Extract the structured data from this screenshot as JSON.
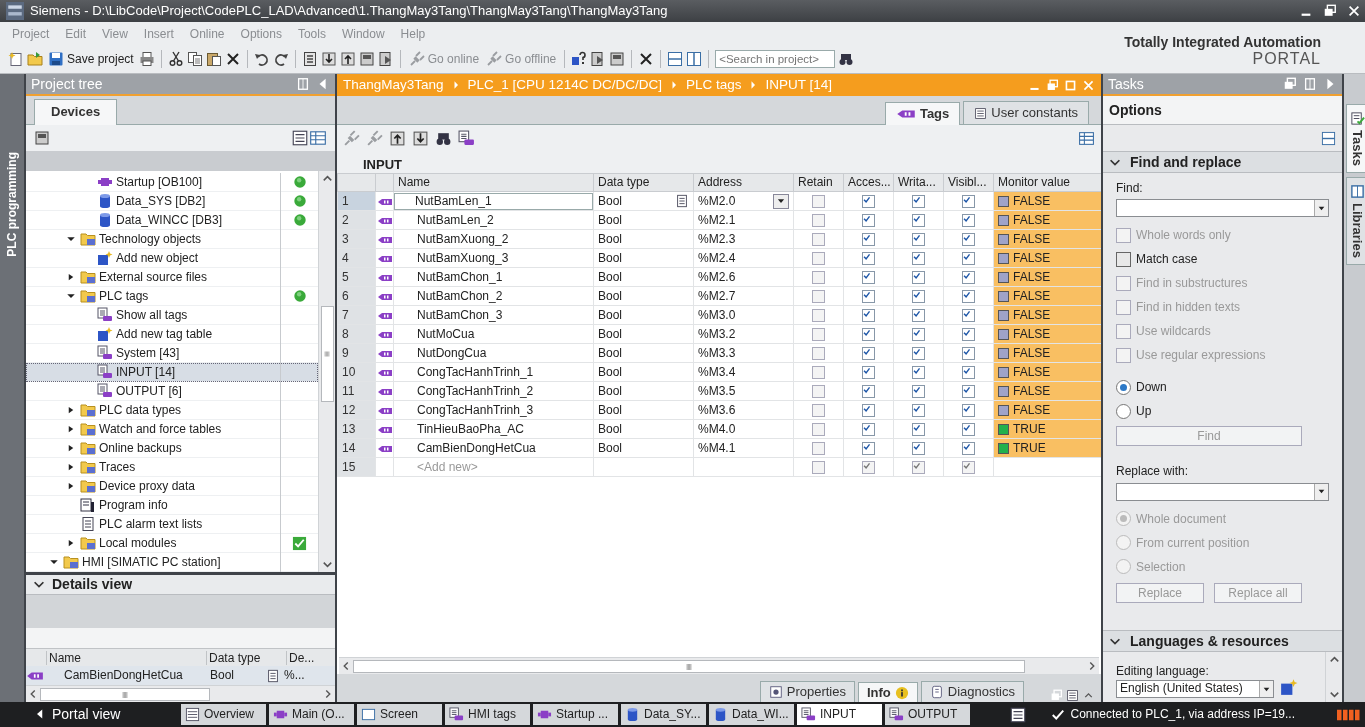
{
  "window": {
    "title": "Siemens  -  D:\\LibCode\\Project\\CodePLC_LAD\\Advanced\\1.ThangMay3Tang\\ThangMay3Tang\\ThangMay3Tang"
  },
  "menu": [
    "Project",
    "Edit",
    "View",
    "Insert",
    "Online",
    "Options",
    "Tools",
    "Window",
    "Help"
  ],
  "toolbar": {
    "buttons": [
      {
        "label": "Save project",
        "disabled": false
      },
      {
        "label": "Go online",
        "disabled": true
      },
      {
        "label": "Go offline",
        "disabled": true
      }
    ],
    "search_placeholder": "<Search in project>"
  },
  "brand": {
    "line1": "Totally Integrated Automation",
    "line2": "PORTAL"
  },
  "side_strip": "PLC programming",
  "project_tree": {
    "title": "Project tree",
    "tabs": [
      {
        "label": "Devices",
        "selected": true
      }
    ],
    "items": [
      {
        "kind": "continued",
        "children": [
          {
            "kind": "continued",
            "children": [
              {
                "kind": "block",
                "label": "Startup [OB100]",
                "status_ok": true,
                "selected": false
              },
              {
                "kind": "db",
                "label": "Data_SYS [DB2]",
                "status_ok": true,
                "selected": false
              },
              {
                "kind": "db",
                "label": "Data_WINCC [DB3]",
                "status_ok": true,
                "selected": false
              }
            ]
          },
          {
            "kind": "folder",
            "label": "Technology objects",
            "expanded": true,
            "selected": false,
            "children": [
              {
                "kind": "add",
                "label": "Add new object",
                "selected": false
              }
            ]
          },
          {
            "kind": "folder",
            "label": "External source files",
            "expanded": false,
            "selected": false
          },
          {
            "kind": "folder",
            "label": "PLC tags",
            "expanded": true,
            "status_ok": true,
            "selected": false,
            "children": [
              {
                "kind": "tags",
                "label": "Show all tags",
                "selected": false
              },
              {
                "kind": "add",
                "label": "Add new tag table",
                "selected": false
              },
              {
                "kind": "tags",
                "label": "System [43]",
                "selected": false
              },
              {
                "kind": "tags",
                "label": "INPUT [14]",
                "selected": true
              },
              {
                "kind": "tags",
                "label": "OUTPUT [6]",
                "selected": false
              }
            ]
          },
          {
            "kind": "folder",
            "label": "PLC data types",
            "expanded": false,
            "selected": false
          },
          {
            "kind": "folder",
            "label": "Watch and force tables",
            "expanded": false,
            "selected": false
          },
          {
            "kind": "folder",
            "label": "Online backups",
            "expanded": false,
            "selected": false
          },
          {
            "kind": "folder",
            "label": "Traces",
            "expanded": false,
            "selected": false
          },
          {
            "kind": "folder",
            "label": "Device proxy data",
            "expanded": false,
            "selected": false
          },
          {
            "kind": "info",
            "label": "Program info",
            "selected": false
          },
          {
            "kind": "list",
            "label": "PLC alarm text lists",
            "selected": false
          },
          {
            "kind": "folder",
            "label": "Local modules",
            "expanded": false,
            "status_checked": true,
            "selected": false
          }
        ]
      },
      {
        "kind": "folder",
        "label": "HMI [SIMATIC PC station]",
        "expanded": true,
        "selected": false
      }
    ]
  },
  "details_view": {
    "title": "Details view",
    "expanded": true,
    "columns": [
      "Name",
      "Data type",
      "De..."
    ],
    "rows": [
      {
        "name": "CamBienDongHetCua",
        "data_type": "Bool",
        "column_3": "%..."
      }
    ]
  },
  "editor": {
    "breadcrumb": [
      "ThangMay3Tang",
      "PLC_1 [CPU 1214C DC/DC/DC]",
      "PLC tags",
      "INPUT [14]"
    ],
    "tabs": [
      {
        "label": "Tags",
        "selected": true
      },
      {
        "label": "User constants",
        "selected": false
      }
    ],
    "table_title": "INPUT",
    "columns": [
      "Name",
      "Data type",
      "Address",
      "Retain",
      "Acces...",
      "Writa...",
      "Visibl...",
      "Monitor value"
    ],
    "rows": [
      {
        "number": "1",
        "name": "NutBamLen_1",
        "data_type": "Bool",
        "address": "%M2.0",
        "retain": false,
        "accessible": true,
        "writable": true,
        "visible": true,
        "monitor": "FALSE",
        "monitor_on": false,
        "selected": true
      },
      {
        "number": "2",
        "name": "NutBamLen_2",
        "data_type": "Bool",
        "address": "%M2.1",
        "retain": false,
        "accessible": true,
        "writable": true,
        "visible": true,
        "monitor": "FALSE",
        "monitor_on": false,
        "selected": false
      },
      {
        "number": "3",
        "name": "NutBamXuong_2",
        "data_type": "Bool",
        "address": "%M2.3",
        "retain": false,
        "accessible": true,
        "writable": true,
        "visible": true,
        "monitor": "FALSE",
        "monitor_on": false,
        "selected": false
      },
      {
        "number": "4",
        "name": "NutBamXuong_3",
        "data_type": "Bool",
        "address": "%M2.4",
        "retain": false,
        "accessible": true,
        "writable": true,
        "visible": true,
        "monitor": "FALSE",
        "monitor_on": false,
        "selected": false
      },
      {
        "number": "5",
        "name": "NutBamChon_1",
        "data_type": "Bool",
        "address": "%M2.6",
        "retain": false,
        "accessible": true,
        "writable": true,
        "visible": true,
        "monitor": "FALSE",
        "monitor_on": false,
        "selected": false
      },
      {
        "number": "6",
        "name": "NutBamChon_2",
        "data_type": "Bool",
        "address": "%M2.7",
        "retain": false,
        "accessible": true,
        "writable": true,
        "visible": true,
        "monitor": "FALSE",
        "monitor_on": false,
        "selected": false
      },
      {
        "number": "7",
        "name": "NutBamChon_3",
        "data_type": "Bool",
        "address": "%M3.0",
        "retain": false,
        "accessible": true,
        "writable": true,
        "visible": true,
        "monitor": "FALSE",
        "monitor_on": false,
        "selected": false
      },
      {
        "number": "8",
        "name": "NutMoCua",
        "data_type": "Bool",
        "address": "%M3.2",
        "retain": false,
        "accessible": true,
        "writable": true,
        "visible": true,
        "monitor": "FALSE",
        "monitor_on": false,
        "selected": false
      },
      {
        "number": "9",
        "name": "NutDongCua",
        "data_type": "Bool",
        "address": "%M3.3",
        "retain": false,
        "accessible": true,
        "writable": true,
        "visible": true,
        "monitor": "FALSE",
        "monitor_on": false,
        "selected": false
      },
      {
        "number": "10",
        "name": "CongTacHanhTrinh_1",
        "data_type": "Bool",
        "address": "%M3.4",
        "retain": false,
        "accessible": true,
        "writable": true,
        "visible": true,
        "monitor": "FALSE",
        "monitor_on": false,
        "selected": false
      },
      {
        "number": "11",
        "name": "CongTacHanhTrinh_2",
        "data_type": "Bool",
        "address": "%M3.5",
        "retain": false,
        "accessible": true,
        "writable": true,
        "visible": true,
        "monitor": "FALSE",
        "monitor_on": false,
        "selected": false
      },
      {
        "number": "12",
        "name": "CongTacHanhTrinh_3",
        "data_type": "Bool",
        "address": "%M3.6",
        "retain": false,
        "accessible": true,
        "writable": true,
        "visible": true,
        "monitor": "FALSE",
        "monitor_on": false,
        "selected": false
      },
      {
        "number": "13",
        "name": "TinHieuBaoPha_AC",
        "data_type": "Bool",
        "address": "%M4.0",
        "retain": false,
        "accessible": true,
        "writable": true,
        "visible": true,
        "monitor": "TRUE",
        "monitor_on": true,
        "selected": false
      },
      {
        "number": "14",
        "name": "CamBienDongHetCua",
        "data_type": "Bool",
        "address": "%M4.1",
        "retain": false,
        "accessible": true,
        "writable": true,
        "visible": true,
        "monitor": "TRUE",
        "monitor_on": true,
        "selected": false
      }
    ],
    "add_row": {
      "number": "15",
      "label": "<Add new>",
      "retain": false,
      "accessible": true,
      "writable": true,
      "visible": true
    },
    "inspector_tabs": [
      {
        "label": "Properties",
        "selected": false
      },
      {
        "label": "Info",
        "selected": true
      },
      {
        "label": "Diagnostics",
        "selected": false
      }
    ]
  },
  "tasks": {
    "title": "Tasks",
    "options": "Options",
    "find_replace": {
      "title": "Find and replace",
      "expanded": true,
      "find_label": "Find:",
      "checkboxes": [
        {
          "label": "Whole words only",
          "checked": false,
          "disabled": true
        },
        {
          "label": "Match case",
          "checked": false,
          "disabled": false
        },
        {
          "label": "Find in substructures",
          "checked": false,
          "disabled": true
        },
        {
          "label": "Find in hidden texts",
          "checked": false,
          "disabled": true
        },
        {
          "label": "Use wildcards",
          "checked": false,
          "disabled": true
        },
        {
          "label": "Use regular expressions",
          "checked": false,
          "disabled": true
        }
      ],
      "direction": [
        {
          "label": "Down",
          "selected": true,
          "disabled": false
        },
        {
          "label": "Up",
          "selected": false,
          "disabled": false
        }
      ],
      "find_button": {
        "label": "Find",
        "disabled": true
      },
      "replace_label": "Replace with:",
      "scope": [
        {
          "label": "Whole document",
          "selected": true,
          "disabled": true
        },
        {
          "label": "From current position",
          "selected": false,
          "disabled": true
        },
        {
          "label": "Selection",
          "selected": false,
          "disabled": true
        }
      ],
      "replace_buttons": [
        {
          "label": "Replace",
          "disabled": true
        },
        {
          "label": "Replace all",
          "disabled": true
        }
      ]
    },
    "languages": {
      "title": "Languages & resources",
      "expanded": true,
      "label": "Editing language:",
      "value": "English (United States)"
    }
  },
  "side_tabs": [
    {
      "label": "Tasks",
      "selected": true
    },
    {
      "label": "Libraries",
      "selected": false
    }
  ],
  "bottom_bar": {
    "portal_view": "Portal view",
    "items": [
      {
        "kind": "overview",
        "label": "Overview",
        "selected": false
      },
      {
        "kind": "block",
        "label": "Main (O...",
        "selected": false
      },
      {
        "kind": "screen",
        "label": "Screen",
        "selected": false
      },
      {
        "kind": "tags",
        "label": "HMI tags",
        "selected": false
      },
      {
        "kind": "block",
        "label": "Startup ...",
        "selected": false
      },
      {
        "kind": "db",
        "label": "Data_SY...",
        "selected": false
      },
      {
        "kind": "db",
        "label": "Data_WI...",
        "selected": false
      },
      {
        "kind": "tags",
        "label": "INPUT",
        "selected": true
      },
      {
        "kind": "tags",
        "label": "OUTPUT",
        "selected": false
      }
    ],
    "status": "Connected to PLC_1, via address IP=19..."
  }
}
